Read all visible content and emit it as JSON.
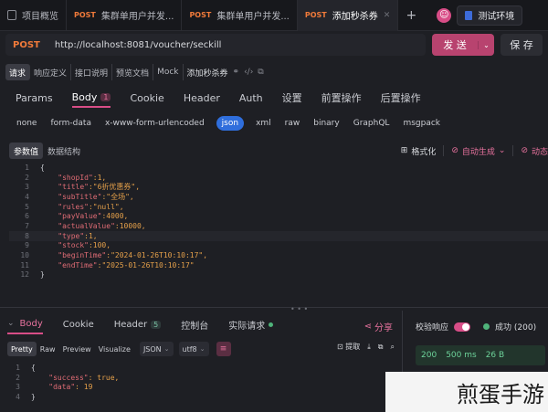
{
  "tabs": [
    {
      "method": "",
      "label": "项目概览",
      "active": false
    },
    {
      "method": "POST",
      "label": "集群单用户并发...",
      "active": false
    },
    {
      "method": "POST",
      "label": "集群单用户并发...",
      "active": false
    },
    {
      "method": "POST",
      "label": "添加秒杀券",
      "active": true
    }
  ],
  "tab_plus": "+",
  "user_avatar": "☺",
  "env_label": "测试环境",
  "request": {
    "method": "POST",
    "url": "http://localhost:8081/voucher/seckill",
    "send_label": "发 送",
    "send_dropdown": "⌄",
    "save_label": "保 存"
  },
  "sub_tabs": [
    "请求",
    "响应定义",
    "接口说明",
    "预览文档",
    "Mock",
    "添加秒杀券"
  ],
  "req_tabs": {
    "params": "Params",
    "body": "Body",
    "body_count": "1",
    "cookie": "Cookie",
    "header": "Header",
    "auth": "Auth",
    "settings": "设置",
    "pre": "前置操作",
    "post": "后置操作"
  },
  "body_types": [
    "none",
    "form-data",
    "x-www-form-urlencoded",
    "json",
    "xml",
    "raw",
    "binary",
    "GraphQL",
    "msgpack"
  ],
  "editor": {
    "tab_params": "参数值",
    "tab_schema": "数据结构",
    "format": "格式化",
    "autogen": "自动生成",
    "dynamic": "动态"
  },
  "code_lines": [
    {
      "n": "1",
      "t": "{"
    },
    {
      "n": "2",
      "k": "\"shopId\"",
      "v": ":1,"
    },
    {
      "n": "3",
      "k": "\"title\"",
      "v": ":\"6折优惠券\","
    },
    {
      "n": "4",
      "k": "\"subTitle\"",
      "v": ":\"全场\","
    },
    {
      "n": "5",
      "k": "\"rules\"",
      "v": ":\"null\","
    },
    {
      "n": "6",
      "k": "\"payValue\"",
      "v": ":4000,"
    },
    {
      "n": "7",
      "k": "\"actualValue\"",
      "v": ":10000,"
    },
    {
      "n": "8",
      "k": "\"type\"",
      "v": ":1,"
    },
    {
      "n": "9",
      "k": "\"stock\"",
      "v": ":100,"
    },
    {
      "n": "10",
      "k": "\"beginTime\"",
      "v": ":\"2024-01-26T10:10:17\","
    },
    {
      "n": "11",
      "k": "\"endTime\"",
      "v": ":\"2025-01-26T10:10:17\""
    },
    {
      "n": "12",
      "t": "}"
    }
  ],
  "response": {
    "tabs": {
      "body": "Body",
      "cookie": "Cookie",
      "header": "Header",
      "header_count": "5",
      "console": "控制台",
      "actual": "实际请求"
    },
    "share": "分享",
    "view_modes": [
      "Pretty",
      "Raw",
      "Preview",
      "Visualize"
    ],
    "format": "JSON",
    "encoding": "utf8",
    "extract": "提取",
    "code_lines": [
      {
        "n": "1",
        "t": "{"
      },
      {
        "n": "2",
        "k": "\"success\"",
        "v": ": true,"
      },
      {
        "n": "3",
        "k": "\"data\"",
        "v": ": 19"
      },
      {
        "n": "4",
        "t": "}"
      }
    ]
  },
  "side": {
    "validate_label": "校验响应",
    "result": "成功 (200)",
    "status": "200",
    "time": "500 ms",
    "size": "26 B"
  },
  "watermark": "煎蛋手游"
}
